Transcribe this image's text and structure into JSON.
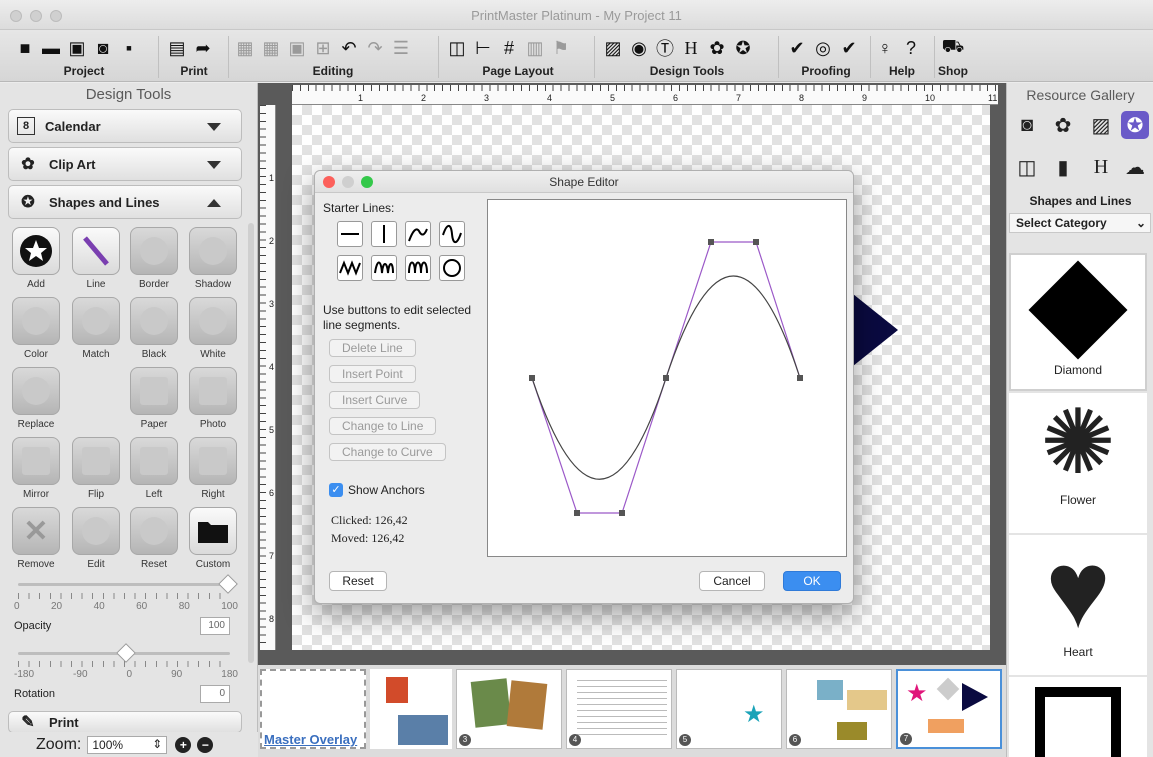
{
  "window": {
    "title": "PrintMaster Platinum - My Project 11"
  },
  "toolbar": {
    "groups": {
      "project": "Project",
      "print": "Print",
      "editing": "Editing",
      "page_layout": "Page Layout",
      "design_tools": "Design Tools",
      "proofing": "Proofing",
      "help": "Help",
      "shop": "Shop"
    }
  },
  "left_panel": {
    "title": "Design Tools",
    "sections": {
      "calendar": "Calendar",
      "clip_art": "Clip Art",
      "shapes_lines": "Shapes and Lines",
      "print": "Print"
    },
    "calendar_icon_text": "8",
    "tools": {
      "add": "Add",
      "line": "Line",
      "border": "Border",
      "shadow": "Shadow",
      "color": "Color",
      "match": "Match",
      "black": "Black",
      "white": "White",
      "replace": "Replace",
      "paper": "Paper",
      "photo": "Photo",
      "mirror": "Mirror",
      "flip": "Flip",
      "left": "Left",
      "right": "Right",
      "remove": "Remove",
      "edit": "Edit",
      "reset": "Reset",
      "custom": "Custom"
    },
    "opacity": {
      "label": "Opacity",
      "value": "100",
      "scale": [
        "0",
        "20",
        "40",
        "60",
        "80",
        "100"
      ]
    },
    "rotation": {
      "label": "Rotation",
      "value": "0",
      "scale": [
        "-180",
        "-90",
        "0",
        "90",
        "180"
      ]
    }
  },
  "zoom": {
    "label": "Zoom:",
    "value": "100%"
  },
  "ruler": {
    "h": [
      "1",
      "2",
      "3",
      "4",
      "5",
      "6",
      "7",
      "8",
      "9",
      "10",
      "11"
    ],
    "v": [
      "1",
      "2",
      "3",
      "4",
      "5",
      "6",
      "7",
      "8"
    ]
  },
  "shape_editor": {
    "title": "Shape Editor",
    "starter_lines_label": "Starter Lines:",
    "instructions": "Use buttons to edit selected line segments.",
    "buttons": {
      "delete_line": "Delete Line",
      "insert_point": "Insert Point",
      "insert_curve": "Insert Curve",
      "change_to_line": "Change to Line",
      "change_to_curve": "Change to Curve"
    },
    "show_anchors": "Show Anchors",
    "clicked": "Clicked: 126,42",
    "moved": "Moved: 126,42",
    "reset": "Reset",
    "cancel": "Cancel",
    "ok": "OK"
  },
  "filmstrip": {
    "master_overlay": "Master Overlay",
    "frames": [
      "3",
      "4",
      "5",
      "6",
      "7"
    ]
  },
  "right_panel": {
    "title": "Resource Gallery",
    "section": "Shapes and Lines",
    "category": "Select Category",
    "shapes": [
      "Diamond",
      "Flower",
      "Heart"
    ]
  },
  "colors": {
    "accent": "#3b8ef0",
    "selected_frame": "#4a90d9",
    "purple_line": "#9b59c8"
  }
}
